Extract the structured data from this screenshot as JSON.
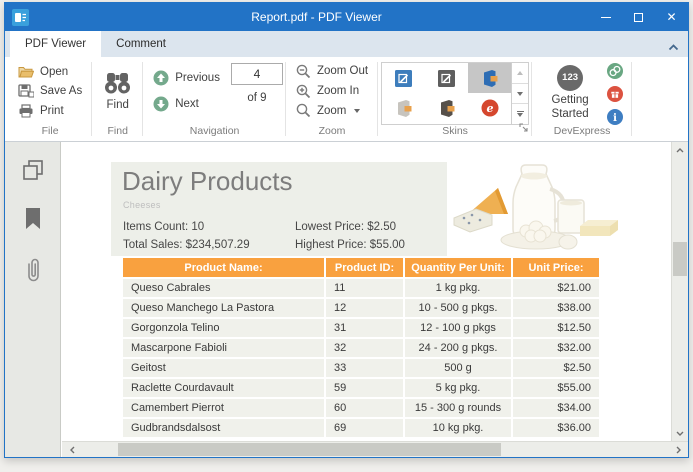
{
  "window": {
    "title": "Report.pdf - PDF Viewer"
  },
  "tabs": {
    "pdf_viewer": "PDF Viewer",
    "comment": "Comment"
  },
  "ribbon": {
    "file": {
      "group_label": "File",
      "open": "Open",
      "save_as": "Save As",
      "print": "Print"
    },
    "find": {
      "group_label": "Find",
      "find": "Find"
    },
    "navigation": {
      "group_label": "Navigation",
      "previous": "Previous",
      "next": "Next",
      "page_value": "4",
      "page_of": "of 9"
    },
    "zoom": {
      "group_label": "Zoom",
      "zoom_out": "Zoom Out",
      "zoom_in": "Zoom In",
      "zoom_menu": "Zoom"
    },
    "skins": {
      "group_label": "Skins",
      "items": [
        "visual-studio-blue-skin-icon",
        "visual-studio-dark-skin-icon",
        "office-colorful-skin-icon",
        "office-light-skin-icon",
        "office-dark-skin-icon",
        "devexpress-style-skin-icon"
      ],
      "selected_index": 2
    },
    "devexpress": {
      "group_label": "DevExpress",
      "getting_started_badge": "123",
      "getting_started": "Getting Started"
    }
  },
  "doc": {
    "title": "Dairy Products",
    "subtitle": "Cheeses",
    "stats": {
      "items_count": "Items Count: 10",
      "total_sales": "Total Sales: $234,507.29",
      "lowest_price": "Lowest Price: $2.50",
      "highest_price": "Highest Price: $55.00"
    },
    "table": {
      "headers": [
        "Product Name:",
        "Product ID:",
        "Quantity Per Unit:",
        "Unit Price:"
      ],
      "rows": [
        [
          "Queso Cabrales",
          "11",
          "1 kg pkg.",
          "$21.00"
        ],
        [
          "Queso Manchego La Pastora",
          "12",
          "10 - 500 g pkgs.",
          "$38.00"
        ],
        [
          "Gorgonzola Telino",
          "31",
          "12 - 100 g pkgs",
          "$12.50"
        ],
        [
          "Mascarpone Fabioli",
          "32",
          "24 - 200 g pkgs.",
          "$32.00"
        ],
        [
          "Geitost",
          "33",
          "500 g",
          "$2.50"
        ],
        [
          "Raclette Courdavault",
          "59",
          "5 kg pkg.",
          "$55.00"
        ],
        [
          "Camembert Pierrot",
          "60",
          "15 - 300 g rounds",
          "$34.00"
        ],
        [
          "Gudbrandsdalsost",
          "69",
          "10 kg pkg.",
          "$36.00"
        ]
      ]
    }
  },
  "colors": {
    "titlebar": "#2273C6",
    "tab_strip": "#DCE5EE",
    "table_header_orange": "#F9A13F",
    "table_row_bg": "#F0F1EB",
    "doc_header_panel": "#EDEFE9",
    "nav_button_green": "#74A98C",
    "getting_started_gray": "#696969",
    "support_green": "#69A782",
    "alert_red": "#DC5240",
    "info_blue": "#3E7EC2",
    "skin_selected_bg": "#C6C6C6"
  }
}
